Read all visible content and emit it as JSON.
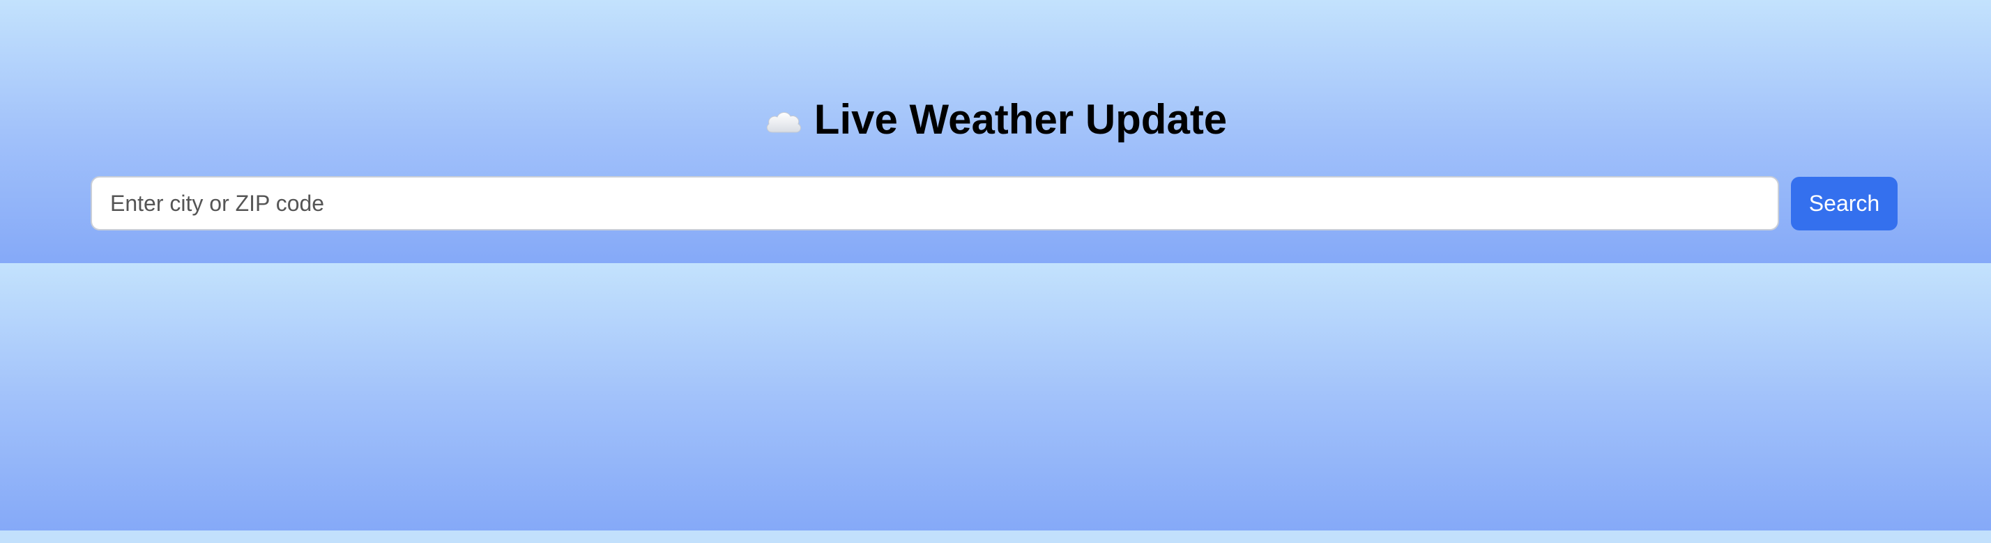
{
  "header": {
    "title_icon": "cloud-icon",
    "title": "Live Weather Update"
  },
  "search": {
    "placeholder": "Enter city or ZIP code",
    "value": "",
    "button_label": "Search"
  },
  "colors": {
    "accent": "#3470ee",
    "background_top": "#c3e2fd",
    "background_bottom": "#85a9f8"
  }
}
